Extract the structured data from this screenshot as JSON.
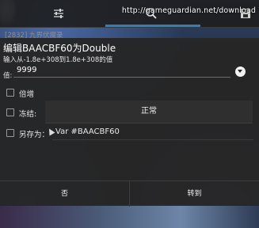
{
  "toolbar": {
    "icons": [
      "tune-icon",
      "search-icon",
      "save-icon"
    ],
    "url": "http://gameguardian.net/download"
  },
  "process": "[2832] 九界伏魔录",
  "dialog": {
    "title": "编辑BAACBF60为Double",
    "hint": "输入从-1.8e+308到1.8e+308的值",
    "value_label": "值:",
    "value": "9999",
    "increment_label": "倍增",
    "freeze_label": "冻结:",
    "freeze_mode": "正常",
    "save_as_label": "另存为：",
    "save_as_value": "Var #BAACBF60",
    "button_no": "否",
    "button_goto": "转到"
  },
  "colors": {
    "accent": "#2f7fbf",
    "dialog_bg": "#262626"
  }
}
